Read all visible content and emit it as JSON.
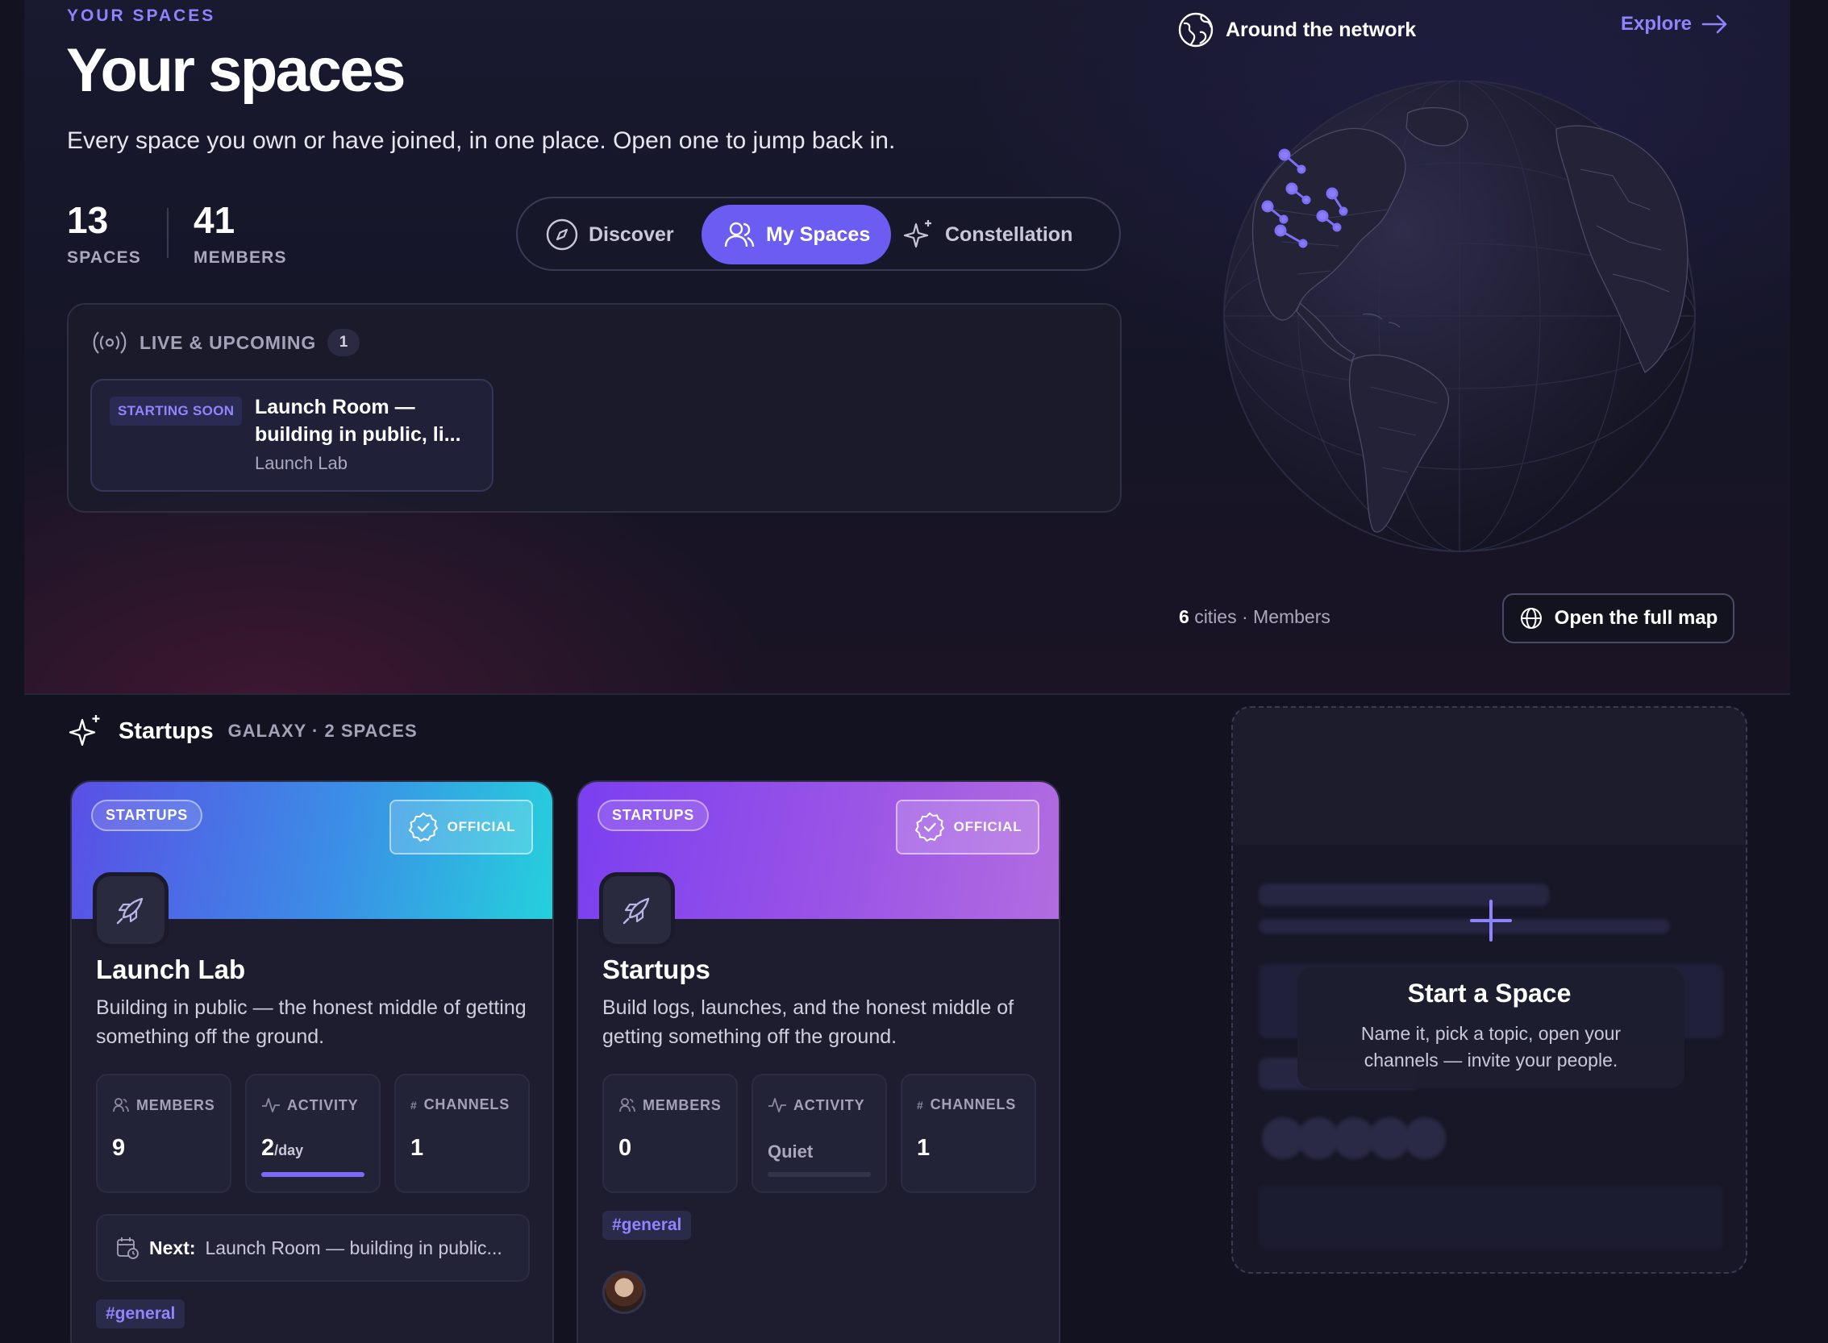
{
  "header": {
    "eyebrow": "YOUR SPACES",
    "title": "Your spaces",
    "subtitle": "Every space you own or have joined, in one place. Open one to jump back in."
  },
  "stats": [
    {
      "value": "13",
      "label": "SPACES"
    },
    {
      "value": "41",
      "label": "MEMBERS"
    }
  ],
  "tabs": [
    {
      "label": "Discover",
      "icon": "compass-icon",
      "active": false
    },
    {
      "label": "My Spaces",
      "icon": "users-icon",
      "active": true
    },
    {
      "label": "Constellation",
      "icon": "sparkles-icon",
      "active": false
    }
  ],
  "live": {
    "title": "LIVE & UPCOMING",
    "count": "1",
    "event": {
      "badge": "STARTING SOON",
      "title": "Launch Room — building in public, li...",
      "org": "Launch Lab"
    }
  },
  "network": {
    "title": "Around the network",
    "explore": "Explore",
    "cities_count": "6",
    "cities_label": "cities · Members",
    "open_map": "Open the full map"
  },
  "galaxy": {
    "name": "Startups",
    "meta": "GALAXY · 2 SPACES"
  },
  "cards": [
    {
      "tag": "STARTUPS",
      "official": "OFFICIAL",
      "name": "Launch Lab",
      "description": "Building in public — the honest middle of getting something off the ground.",
      "members_label": "MEMBERS",
      "members": "9",
      "activity_label": "ACTIVITY",
      "activity": "2",
      "activity_unit": "/day",
      "activity_level": 1.0,
      "channels_label": "CHANNELS",
      "channels": "1",
      "next_label": "Next:",
      "next_value": "Launch Room — building in public...",
      "channel_chip": "#general",
      "banner_colors": [
        "#5a4fe6",
        "#25d0dc"
      ]
    },
    {
      "tag": "STARTUPS",
      "official": "OFFICIAL",
      "name": "Startups",
      "description": "Build logs, launches, and the honest middle of getting something off the ground.",
      "members_label": "MEMBERS",
      "members": "0",
      "activity_label": "ACTIVITY",
      "activity": "Quiet",
      "activity_level": 0,
      "channels_label": "CHANNELS",
      "channels": "1",
      "channel_chip": "#general",
      "banner_colors": [
        "#7b3ff0",
        "#b26ce0"
      ]
    }
  ],
  "start_space": {
    "title": "Start a Space",
    "description": "Name it, pick a topic, open your channels — invite your people."
  },
  "colors": {
    "accent": "#6b5cf2",
    "accent_text": "#8e84ff",
    "background": "#121220"
  }
}
